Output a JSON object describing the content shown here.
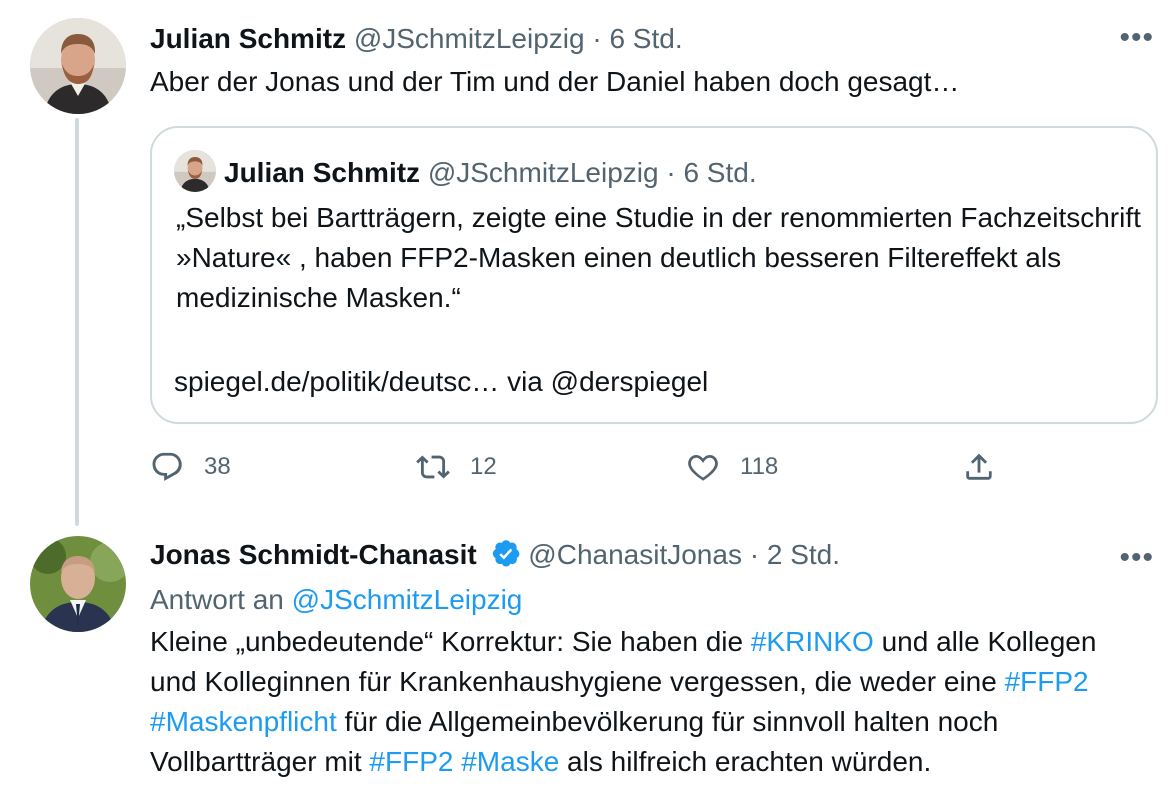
{
  "tweets": [
    {
      "author": "Julian Schmitz",
      "handle": "@JSchmitzLeipzig",
      "separator": "·",
      "time": "6 Std.",
      "text": "Aber der Jonas und der Tim und der Daniel haben doch gesagt…",
      "quote": {
        "author": "Julian Schmitz",
        "handle": "@JSchmitzLeipzig",
        "separator": "·",
        "time": "6 Std.",
        "text": "„Selbst bei Bartträgern, zeigte eine Studie in der renommierten Fachzeitschrift »Nature« , haben FFP2-Masken einen deutlich besseren Filtereffekt als medizinische Masken.“",
        "link_line": "spiegel.de/politik/deutsc… via @derspiegel"
      },
      "actions": {
        "replies": "38",
        "retweets": "12",
        "likes": "118"
      },
      "more_icon": "more-icon"
    },
    {
      "author": "Jonas Schmidt-Chanasit",
      "verified": true,
      "handle": "@ChanasitJonas",
      "separator": "·",
      "time": "2 Std.",
      "reply_prefix": "Antwort an",
      "reply_to": "@JSchmitzLeipzig",
      "text_parts": {
        "p1": "Kleine „unbedeutende“ Korrektur: Sie haben die ",
        "tag1": "#KRINKO",
        "p2": " und alle Kollegen und Kolleginnen für Krankenhaushygiene vergessen, die weder eine ",
        "tag2": "#FFP2",
        "sp1": " ",
        "tag3": "#Maskenpflicht",
        "p3": " für die Allgemeinbevölkerung für sinnvoll halten noch Vollbartträger mit ",
        "tag4": "#FFP2",
        "sp2": " ",
        "tag5": "#Maske",
        "p4": " als hilfreich erachten würden."
      }
    }
  ],
  "colors": {
    "text": "#0f1419",
    "secondary": "#536471",
    "link": "#1d9bf0",
    "border": "#cfd9de"
  },
  "icons": [
    "reply-icon",
    "retweet-icon",
    "like-icon",
    "share-icon",
    "verified-badge-icon",
    "more-icon"
  ]
}
